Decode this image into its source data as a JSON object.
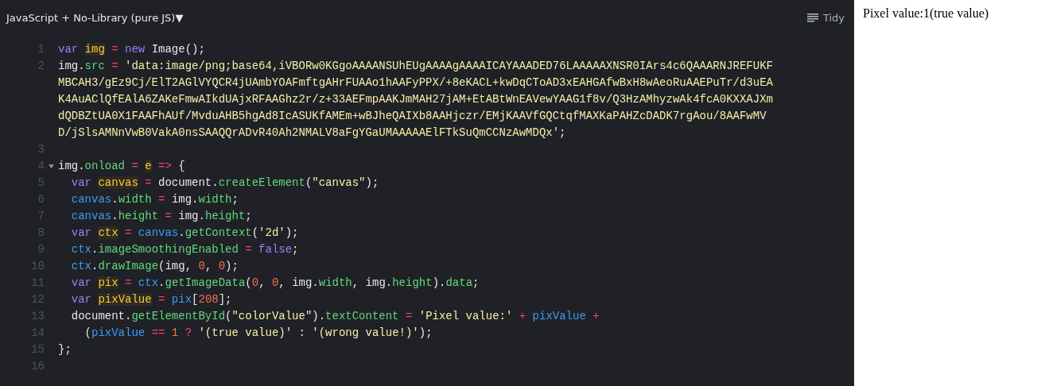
{
  "editor": {
    "language": "JavaScript + No-Library (pure JS)",
    "language_caret": "▼",
    "tidy_button": "Tidy",
    "rows": [
      {
        "number": "1",
        "indent": "",
        "tokens": [
          {
            "kind": "keyword",
            "text": "var "
          },
          {
            "kind": "decl",
            "text": "img"
          },
          {
            "kind": "op",
            "text": " = "
          },
          {
            "kind": "keyword",
            "text": "new"
          },
          {
            "kind": "plain",
            "text": " Image();"
          }
        ]
      },
      {
        "number": "2",
        "indent": "",
        "tokens": [
          {
            "kind": "plain",
            "text": "img."
          },
          {
            "kind": "prop",
            "text": "src"
          },
          {
            "kind": "op",
            "text": " = "
          },
          {
            "kind": "string",
            "text": "'data:image/png;base64,iVBORw0KGgoAAAANSUhEUgAAAAgAAAAICAYAAADED76LAAAAAXNSR0IArs4c6QAAARNJREFUKF"
          }
        ]
      },
      {
        "indent": "",
        "tokens": [
          {
            "kind": "string",
            "text": "MBCAH3/gEz9Cj/ElT2AGlVYQCR4jUAmbYOAFmftgAHrFUAAo1hAAFyPPX/+8eKACL+kwDqCToAD3xEAHGAfwBxH8wAeoRuAAEPuTr/d3uEA"
          }
        ]
      },
      {
        "indent": "",
        "tokens": [
          {
            "kind": "string",
            "text": "K4AuAClQfEAlA6ZAKeFmwAIkdUAjxRFAAGhz2r/z+33AEFmpAAKJmMAH27jAM+EtABtWnEAVewYAAG1f8v/Q3HzAMhyzwAk4fcA0KXXAJXm"
          }
        ]
      },
      {
        "indent": "",
        "tokens": [
          {
            "kind": "string",
            "text": "dQDBZtUA0X1FAAFhAUf/MvduAHB5hgAd8IcASUKfAMEm+wBJheQAIXb8AAHjczr/EMjKAAVfGQCtqfMAXKaPAHZcDADK7rgAou/8AAFwMV"
          }
        ]
      },
      {
        "indent": "",
        "tokens": [
          {
            "kind": "string",
            "text": "D/jSlsAMNnVwB0VakA0nsSAAQQrADvR40Ah2NMALV8aFgYGaUMAAAAAElFTkSuQmCCNzAwMDQx'"
          },
          {
            "kind": "plain",
            "text": ";"
          }
        ]
      },
      {
        "number": "3",
        "indent": "",
        "tokens": []
      },
      {
        "number": "4",
        "indent": "",
        "expanded": true,
        "tokens": [
          {
            "kind": "plain",
            "text": "img."
          },
          {
            "kind": "prop",
            "text": "onload"
          },
          {
            "kind": "op",
            "text": " = "
          },
          {
            "kind": "decl",
            "text": "e"
          },
          {
            "kind": "op",
            "text": " => "
          },
          {
            "kind": "plain",
            "text": "{"
          }
        ]
      },
      {
        "number": "5",
        "indent": "  ",
        "tokens": [
          {
            "kind": "keyword",
            "text": "var "
          },
          {
            "kind": "decl",
            "text": "canvas"
          },
          {
            "kind": "op",
            "text": " = "
          },
          {
            "kind": "plain",
            "text": "document."
          },
          {
            "kind": "prop",
            "text": "createElement"
          },
          {
            "kind": "plain",
            "text": "("
          },
          {
            "kind": "string",
            "text": "\"canvas\""
          },
          {
            "kind": "plain",
            "text": ");"
          }
        ]
      },
      {
        "number": "6",
        "indent": "  ",
        "tokens": [
          {
            "kind": "ident",
            "text": "canvas"
          },
          {
            "kind": "plain",
            "text": "."
          },
          {
            "kind": "prop",
            "text": "width"
          },
          {
            "kind": "op",
            "text": " = "
          },
          {
            "kind": "plain",
            "text": "img."
          },
          {
            "kind": "prop",
            "text": "width"
          },
          {
            "kind": "plain",
            "text": ";"
          }
        ]
      },
      {
        "number": "7",
        "indent": "  ",
        "tokens": [
          {
            "kind": "ident",
            "text": "canvas"
          },
          {
            "kind": "plain",
            "text": "."
          },
          {
            "kind": "prop",
            "text": "height"
          },
          {
            "kind": "op",
            "text": " = "
          },
          {
            "kind": "plain",
            "text": "img."
          },
          {
            "kind": "prop",
            "text": "height"
          },
          {
            "kind": "plain",
            "text": ";"
          }
        ]
      },
      {
        "number": "8",
        "indent": "  ",
        "tokens": [
          {
            "kind": "keyword",
            "text": "var "
          },
          {
            "kind": "decl",
            "text": "ctx"
          },
          {
            "kind": "op",
            "text": " = "
          },
          {
            "kind": "ident",
            "text": "canvas"
          },
          {
            "kind": "plain",
            "text": "."
          },
          {
            "kind": "prop",
            "text": "getContext"
          },
          {
            "kind": "plain",
            "text": "("
          },
          {
            "kind": "string",
            "text": "'2d'"
          },
          {
            "kind": "plain",
            "text": ");"
          }
        ]
      },
      {
        "number": "9",
        "indent": "  ",
        "tokens": [
          {
            "kind": "ident",
            "text": "ctx"
          },
          {
            "kind": "plain",
            "text": "."
          },
          {
            "kind": "prop",
            "text": "imageSmoothingEnabled"
          },
          {
            "kind": "op",
            "text": " = "
          },
          {
            "kind": "keyword",
            "text": "false"
          },
          {
            "kind": "plain",
            "text": ";"
          }
        ]
      },
      {
        "number": "10",
        "indent": "  ",
        "tokens": [
          {
            "kind": "ident",
            "text": "ctx"
          },
          {
            "kind": "plain",
            "text": "."
          },
          {
            "kind": "prop",
            "text": "drawImage"
          },
          {
            "kind": "plain",
            "text": "(img, "
          },
          {
            "kind": "number",
            "text": "0"
          },
          {
            "kind": "plain",
            "text": ", "
          },
          {
            "kind": "number",
            "text": "0"
          },
          {
            "kind": "plain",
            "text": ");"
          }
        ]
      },
      {
        "number": "11",
        "indent": "  ",
        "tokens": [
          {
            "kind": "keyword",
            "text": "var "
          },
          {
            "kind": "decl",
            "text": "pix"
          },
          {
            "kind": "op",
            "text": " = "
          },
          {
            "kind": "ident",
            "text": "ctx"
          },
          {
            "kind": "plain",
            "text": "."
          },
          {
            "kind": "prop",
            "text": "getImageData"
          },
          {
            "kind": "plain",
            "text": "("
          },
          {
            "kind": "number",
            "text": "0"
          },
          {
            "kind": "plain",
            "text": ", "
          },
          {
            "kind": "number",
            "text": "0"
          },
          {
            "kind": "plain",
            "text": ", img."
          },
          {
            "kind": "prop",
            "text": "width"
          },
          {
            "kind": "plain",
            "text": ", img."
          },
          {
            "kind": "prop",
            "text": "height"
          },
          {
            "kind": "plain",
            "text": ")."
          },
          {
            "kind": "prop",
            "text": "data"
          },
          {
            "kind": "plain",
            "text": ";"
          }
        ]
      },
      {
        "number": "12",
        "indent": "  ",
        "tokens": [
          {
            "kind": "keyword",
            "text": "var "
          },
          {
            "kind": "decl",
            "text": "pixValue"
          },
          {
            "kind": "op",
            "text": " = "
          },
          {
            "kind": "ident",
            "text": "pix"
          },
          {
            "kind": "plain",
            "text": "["
          },
          {
            "kind": "number",
            "text": "208"
          },
          {
            "kind": "plain",
            "text": "];"
          }
        ]
      },
      {
        "number": "13",
        "indent": "  ",
        "tokens": [
          {
            "kind": "plain",
            "text": "document."
          },
          {
            "kind": "prop",
            "text": "getElementById"
          },
          {
            "kind": "plain",
            "text": "("
          },
          {
            "kind": "string",
            "text": "\"colorValue\""
          },
          {
            "kind": "plain",
            "text": ")."
          },
          {
            "kind": "prop",
            "text": "textContent"
          },
          {
            "kind": "op",
            "text": " = "
          },
          {
            "kind": "string",
            "text": "'Pixel value:'"
          },
          {
            "kind": "op",
            "text": " + "
          },
          {
            "kind": "ident",
            "text": "pixValue"
          },
          {
            "kind": "op",
            "text": " +"
          }
        ]
      },
      {
        "number": "14",
        "indent": "    ",
        "tokens": [
          {
            "kind": "plain",
            "text": "("
          },
          {
            "kind": "ident",
            "text": "pixValue"
          },
          {
            "kind": "op",
            "text": " == "
          },
          {
            "kind": "number",
            "text": "1"
          },
          {
            "kind": "op",
            "text": " ? "
          },
          {
            "kind": "string",
            "text": "'(true value)'"
          },
          {
            "kind": "plain",
            "text": " : "
          },
          {
            "kind": "string",
            "text": "'(wrong value!)'"
          },
          {
            "kind": "plain",
            "text": ");"
          }
        ]
      },
      {
        "number": "15",
        "indent": "",
        "tokens": [
          {
            "kind": "plain",
            "text": "};"
          }
        ]
      },
      {
        "number": "16",
        "indent": "",
        "tokens": []
      }
    ]
  },
  "result": {
    "output": "Pixel value:1(true value)"
  }
}
